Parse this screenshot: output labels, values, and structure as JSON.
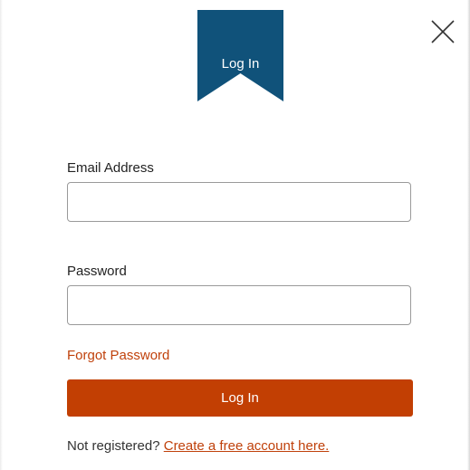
{
  "banner": {
    "title": "Log In",
    "color": "#10527a"
  },
  "close": {
    "icon": "close-icon"
  },
  "form": {
    "email_label": "Email Address",
    "email_value": "",
    "password_label": "Password",
    "password_value": "",
    "forgot_label": "Forgot Password",
    "submit_label": "Log In",
    "accent_color": "#c23f03"
  },
  "register": {
    "prompt": "Not registered?",
    "link_label": "Create a free account here."
  }
}
